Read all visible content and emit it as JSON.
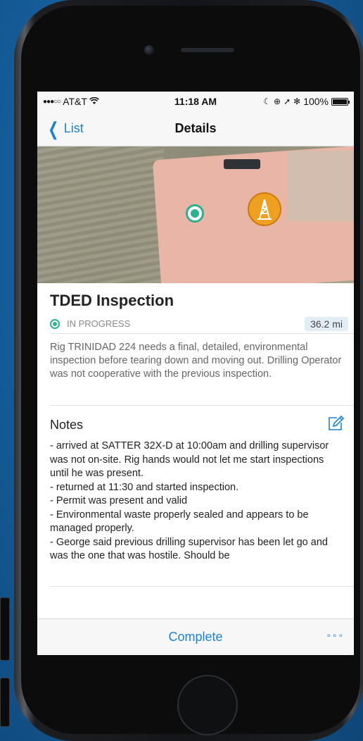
{
  "statusbar": {
    "signal": "●●●○○",
    "carrier": "AT&T",
    "wifi_icon": "wifi-icon",
    "time": "11:18 AM",
    "battery": "100%"
  },
  "navbar": {
    "back_label": "List",
    "title": "Details"
  },
  "inspection": {
    "title": "TDED Inspection",
    "status": "IN PROGRESS",
    "distance": "36.2 mi",
    "description": "Rig TRINIDAD 224 needs a final, detailed, environmental inspection before tearing down and moving out. Drilling Operator was not cooperative with the previous inspection."
  },
  "notes": {
    "title": "Notes",
    "lines": [
      "- arrived at SATTER 32X-D at 10:00am and drilling supervisor was not on-site. Rig hands would not let me start inspections until he was present.",
      "- returned at 11:30 and started inspection.",
      "- Permit was present and valid",
      "- Environmental waste properly sealed and appears to be managed properly.",
      "- George said previous drilling supervisor has been let go and was the one that was hostile. Should be"
    ]
  },
  "bottombar": {
    "complete_label": "Complete",
    "more_label": "∘∘∘"
  },
  "colors": {
    "accent": "#1a82d6",
    "status_green": "#2bb090",
    "rig_marker": "#f0a020"
  }
}
